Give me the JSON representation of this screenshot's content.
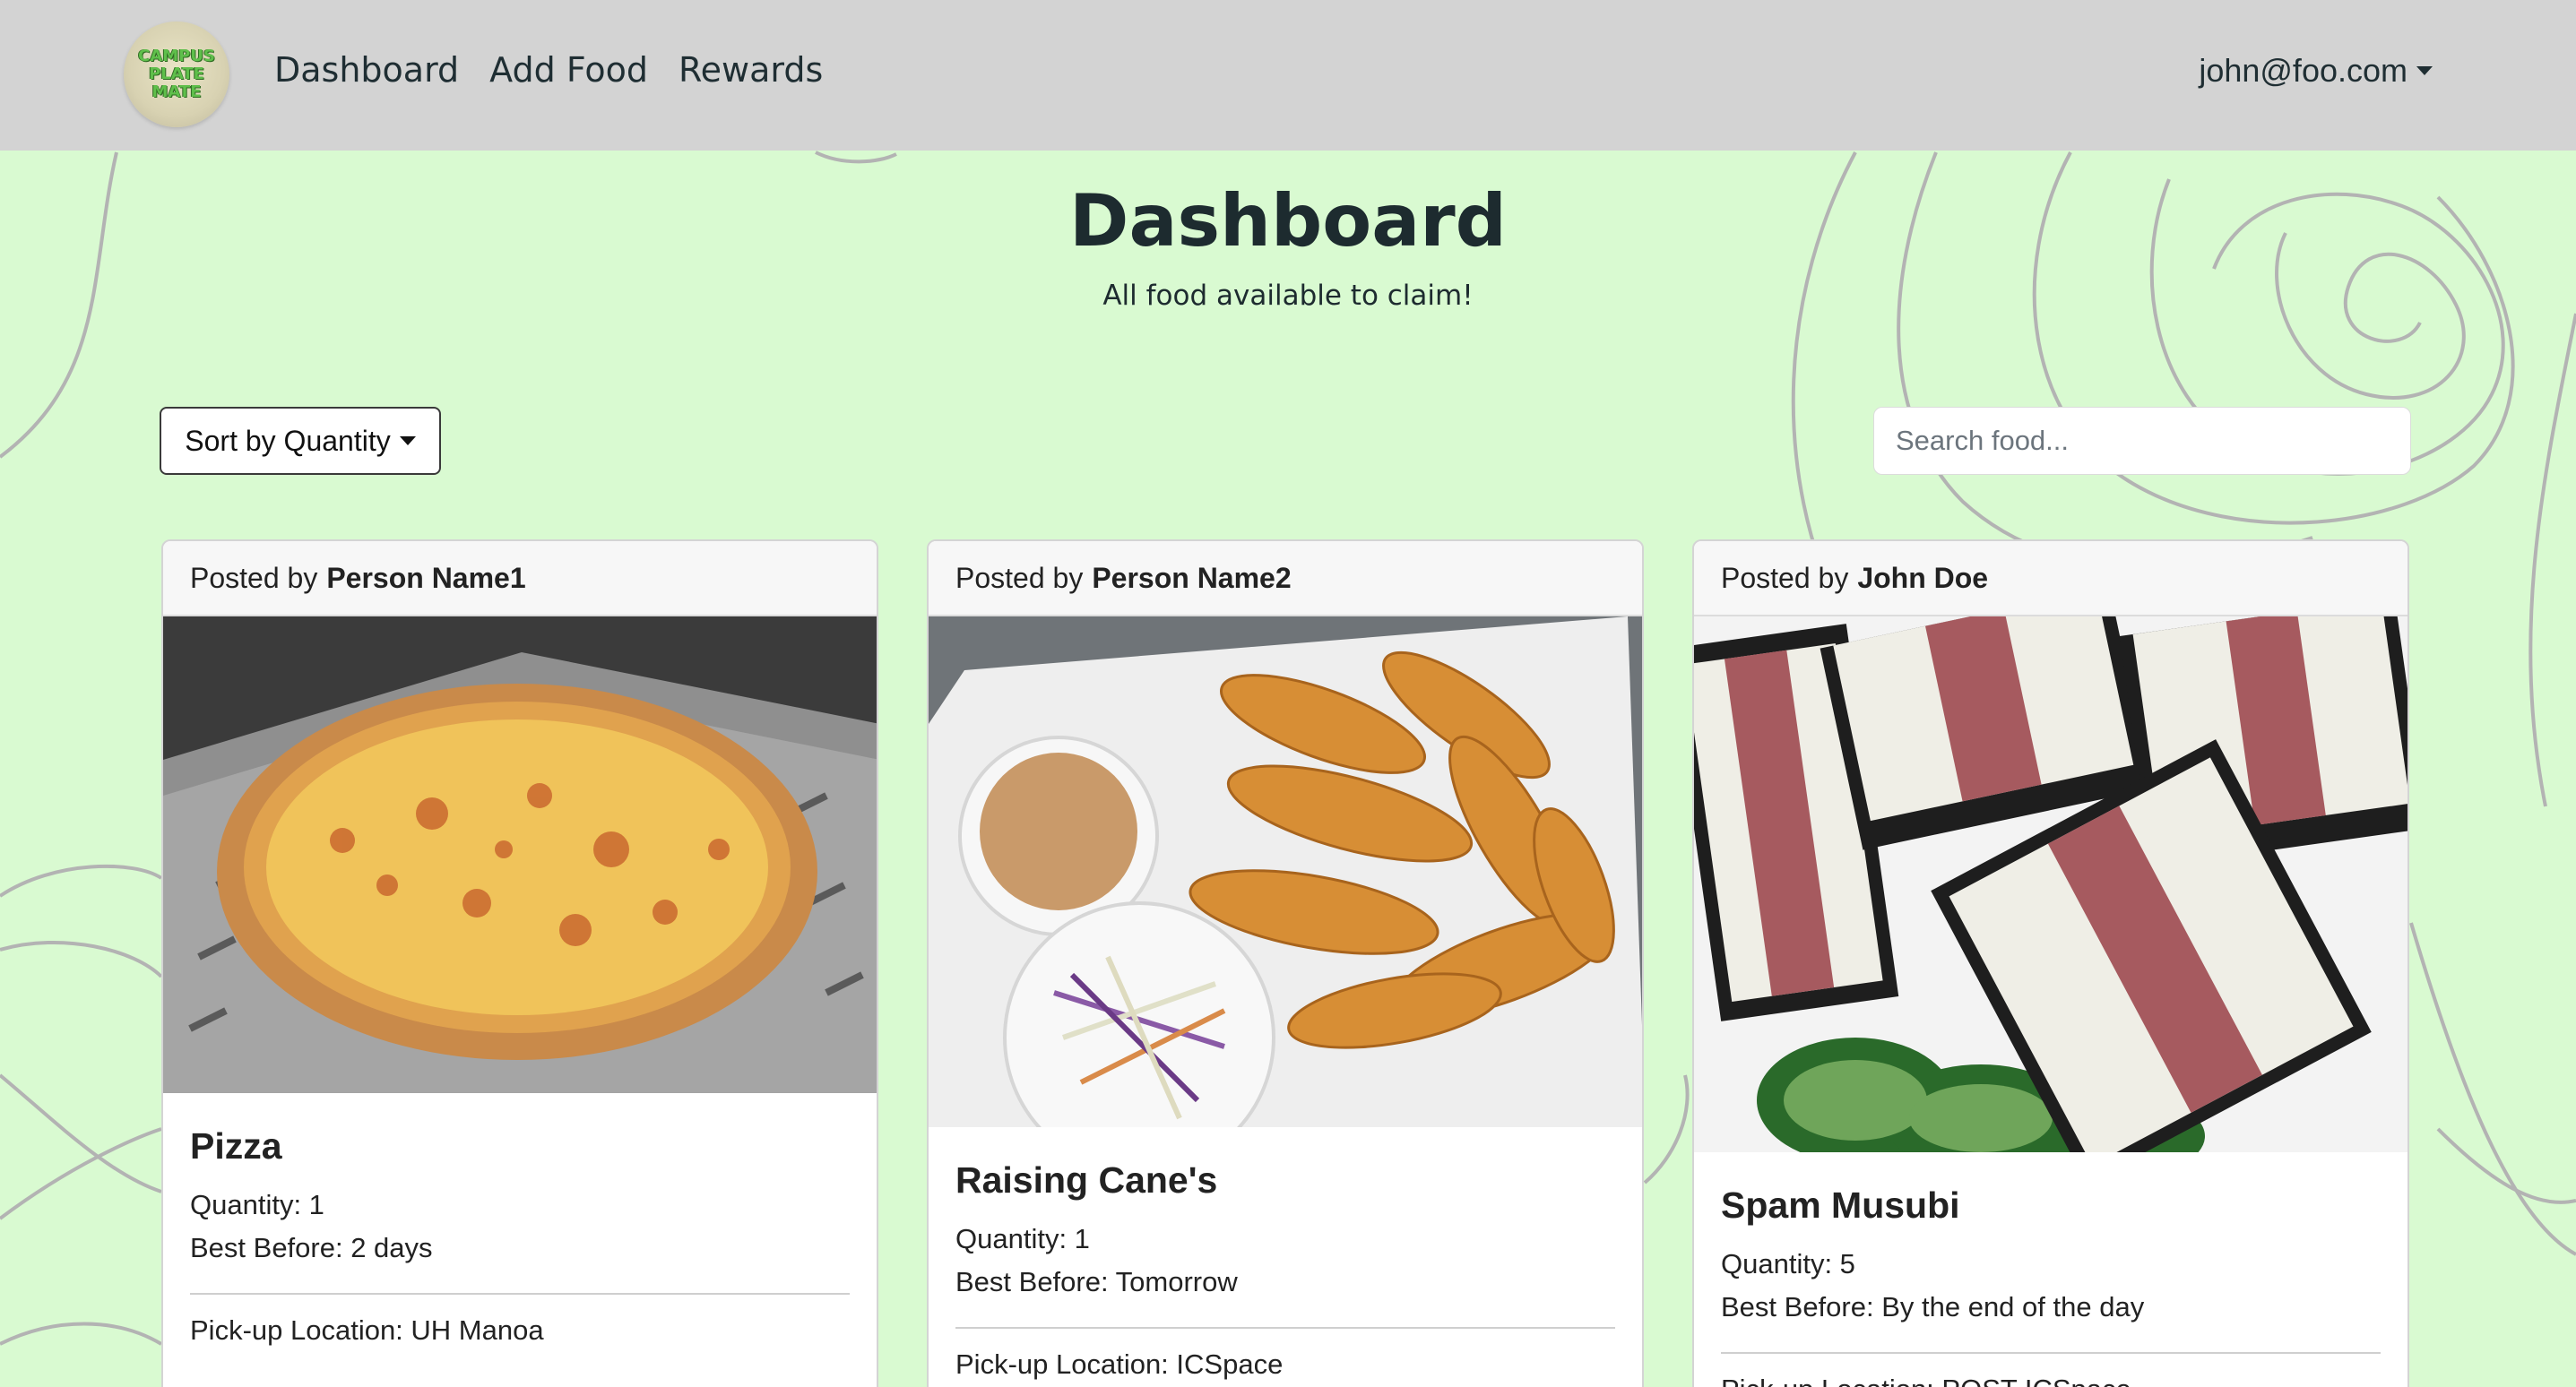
{
  "app": {
    "logo_text": [
      "CAMPUS",
      "PLATE",
      "MATE"
    ]
  },
  "navbar": {
    "links": [
      {
        "label": "Dashboard"
      },
      {
        "label": "Add Food"
      },
      {
        "label": "Rewards"
      }
    ],
    "user_email": "john@foo.com"
  },
  "page": {
    "title": "Dashboard",
    "subtitle": "All food available to claim!"
  },
  "controls": {
    "sort_label": "Sort by Quantity",
    "search_placeholder": "Search food..."
  },
  "cards": [
    {
      "posted_prefix": "Posted by",
      "poster": "Person Name1",
      "title": "Pizza",
      "quantity": "Quantity: 1",
      "best_before": "Best Before: 2 days",
      "location": "Pick-up Location: UH Manoa"
    },
    {
      "posted_prefix": "Posted by",
      "poster": "Person Name2",
      "title": "Raising Cane's",
      "quantity": "Quantity: 1",
      "best_before": "Best Before: Tomorrow",
      "location": "Pick-up Location: ICSpace"
    },
    {
      "posted_prefix": "Posted by",
      "poster": "John Doe",
      "title": "Spam Musubi",
      "quantity": "Quantity: 5",
      "best_before": "Best Before: By the end of the day",
      "location": "Pick-up Location: POST ICSpace"
    }
  ],
  "colors": {
    "background": "#d9fad1",
    "navbar": "#d3d3d3",
    "swirl": "#b0b0b0"
  }
}
